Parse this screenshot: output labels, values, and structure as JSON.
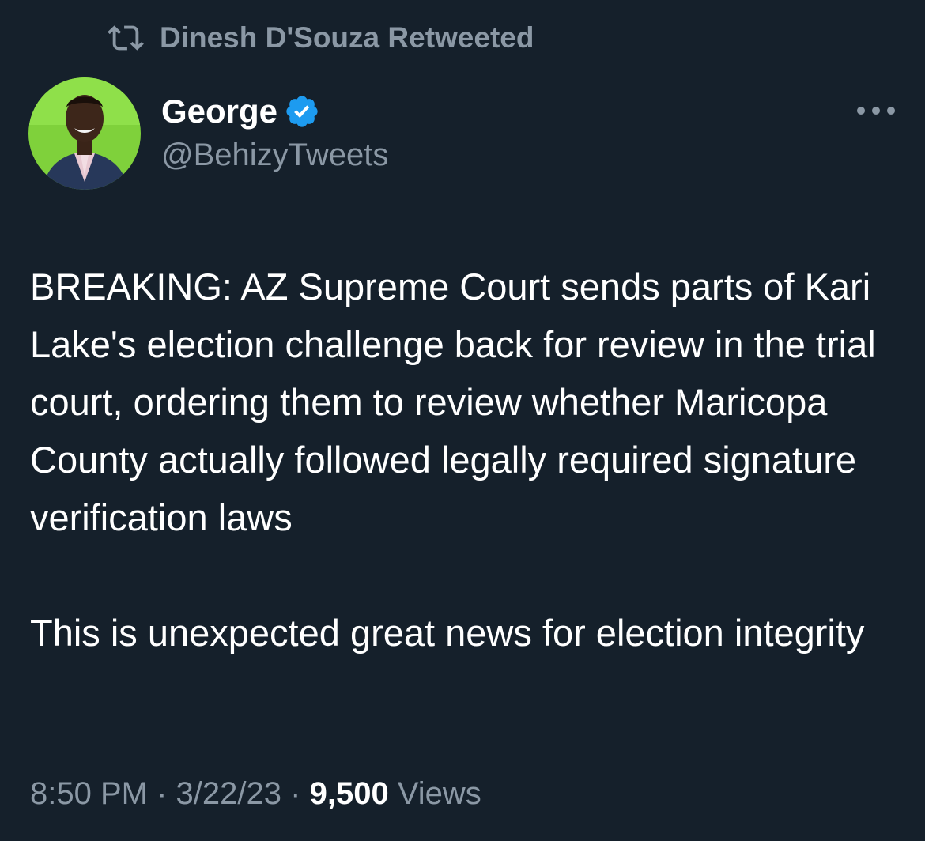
{
  "social_context": {
    "icon": "retweet-icon",
    "text": "Dinesh D'Souza Retweeted"
  },
  "author": {
    "name": "George",
    "handle": "@BehizyTweets",
    "verified": true,
    "verified_color": "#1d9bf0"
  },
  "tweet": {
    "paragraphs": [
      "BREAKING: AZ Supreme Court sends parts of Kari Lake's election challenge back for review in the trial court, ordering them to review whether Maricopa County actually followed legally required signature verification laws",
      "This is unexpected great news for election integrity"
    ]
  },
  "meta": {
    "time": "8:50 PM",
    "separator": "·",
    "date": "3/22/23",
    "views_count": "9,500",
    "views_label": "Views"
  },
  "colors": {
    "background": "#15202b",
    "text_primary": "#ffffff",
    "text_secondary": "#8b98a5",
    "accent": "#1d9bf0"
  }
}
